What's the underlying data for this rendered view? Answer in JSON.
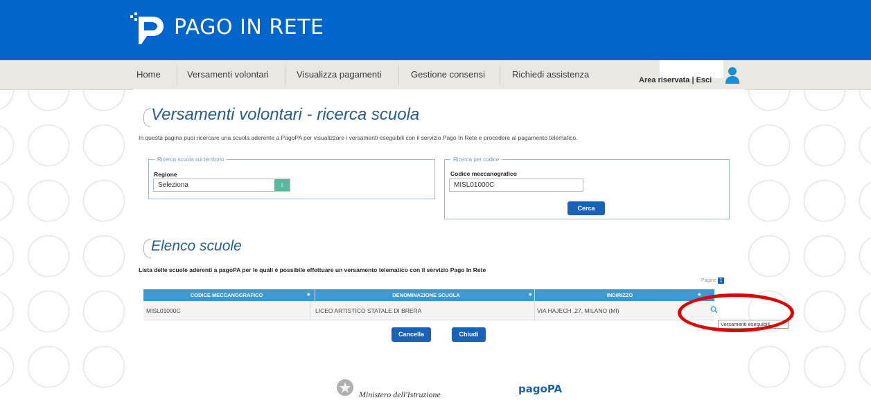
{
  "header": {
    "brand": "PAGO IN RETE",
    "logo_icon": "pago-in-rete-logo-icon",
    "color": "#0166cc"
  },
  "nav": {
    "items": [
      {
        "label": "Home"
      },
      {
        "label": "Versamenti volontari"
      },
      {
        "label": "Visualizza pagamenti"
      },
      {
        "label": "Gestione consensi"
      },
      {
        "label": "Richiedi assistenza"
      }
    ],
    "area_label": "Area riservata | Esci",
    "user_icon": "user-icon"
  },
  "page": {
    "title": "Versamenti volontari - ricerca scuola",
    "intro": "In questa pagina puoi ricercare una scuola aderente a PagoPA per visualizzare i versamenti eseguibili con il servizio Pago In Rete e procedere al pagamento telematico."
  },
  "search_territory": {
    "legend": "Ricerca scuola sul territorio",
    "regione_label": "Regione",
    "regione_value": "Seleziona"
  },
  "search_code": {
    "legend": "Ricerca per codice",
    "codice_label": "Codice meccanografico",
    "codice_value": "MISL01000C",
    "button": "Cerca"
  },
  "list": {
    "title": "Elenco scuole",
    "description": "Lista delle scuole aderenti a pagoPA per le quali è possibile effettuare un versamento telematico con il servizio Pago In Rete",
    "pages_label": "Pagine",
    "page_number": "1",
    "columns": [
      "CODICE MECCANOGRAFICO",
      "DENOMINAZIONE SCUOLA",
      "INDIRIZZO"
    ],
    "rows": [
      {
        "codice": "MISL01000C",
        "denominazione": "LICEO ARTISTICO STATALE DI BRERA",
        "indirizzo": "VIA HAJECH ,27, MILANO (MI)"
      }
    ],
    "tooltip": "Versamenti eseguibili",
    "cancel_button": "Cancella",
    "close_button": "Chiudi"
  },
  "footer": {
    "ministry": "Ministero dell'Istruzione",
    "pagopa": "pagoPA"
  },
  "colors": {
    "primary": "#0166cc",
    "table_header": "#3a9ad8",
    "button": "#1a62b8",
    "highlight": "#e00000"
  }
}
